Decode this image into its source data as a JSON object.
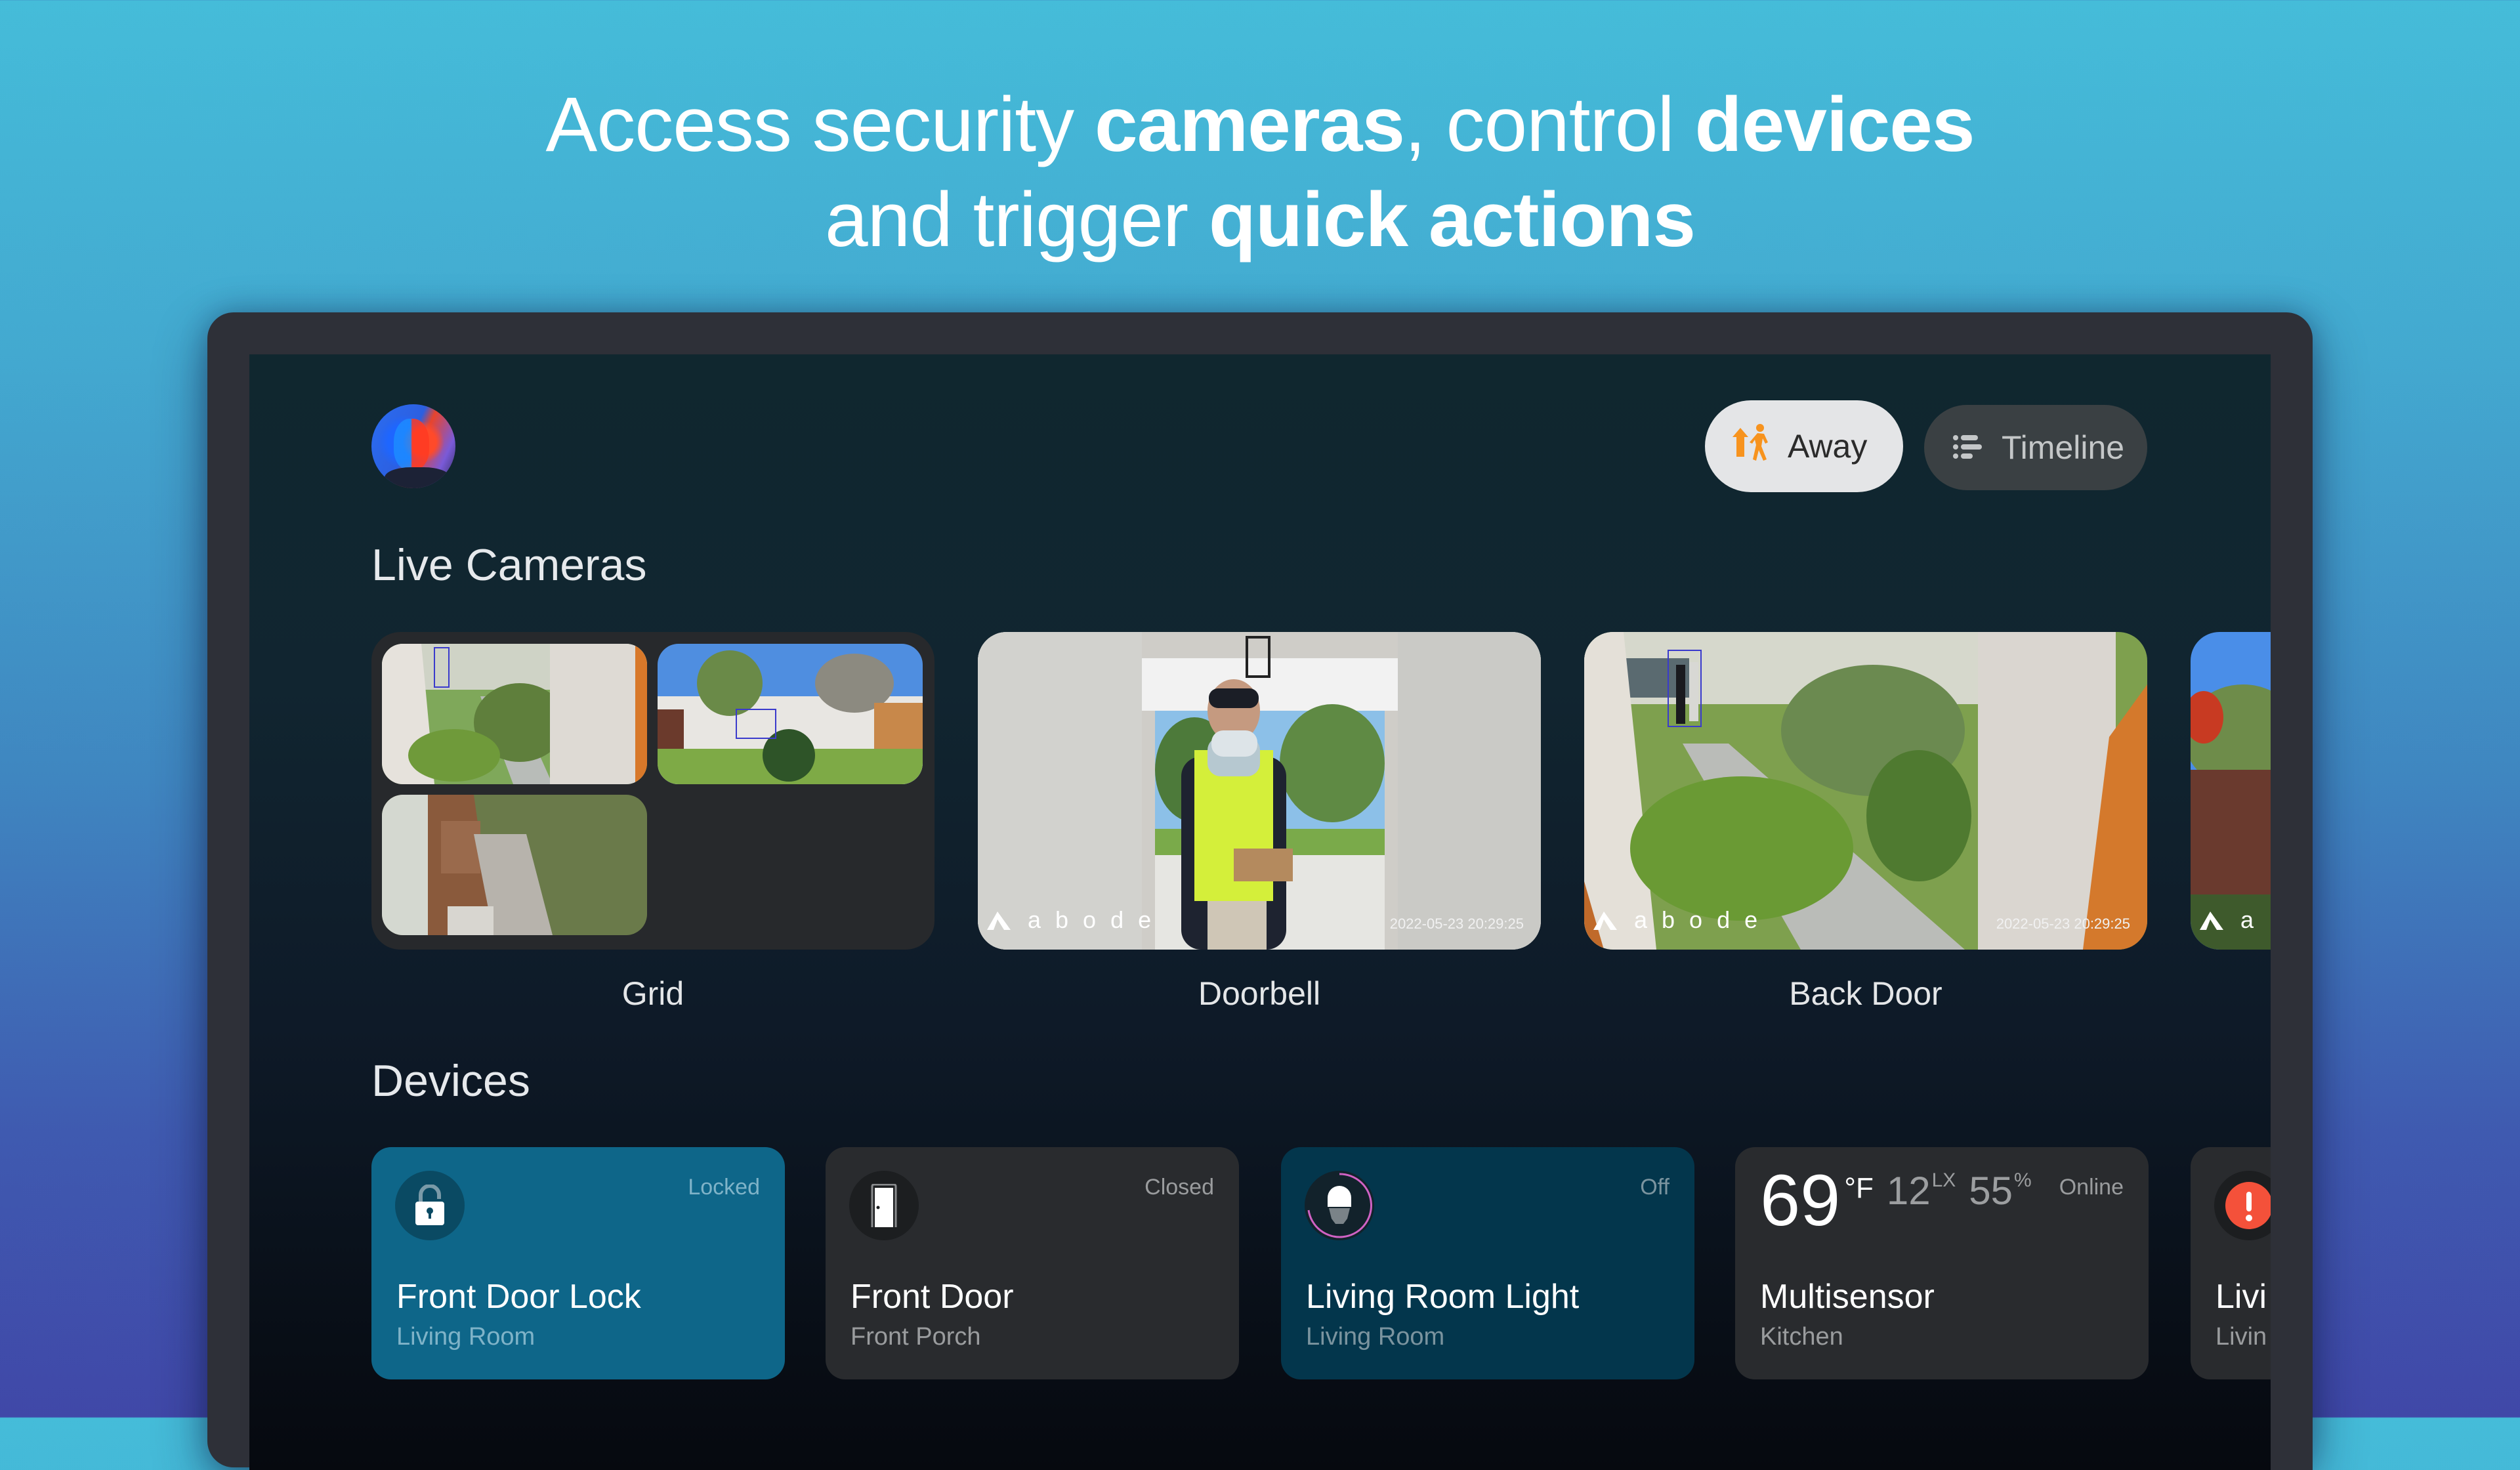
{
  "headline": {
    "line1": [
      {
        "text": "Access security ",
        "bold": false
      },
      {
        "text": "cameras",
        "bold": true
      },
      {
        "text": ", control ",
        "bold": false
      },
      {
        "text": "devices",
        "bold": true
      }
    ],
    "line2": [
      {
        "text": "and trigger ",
        "bold": false
      },
      {
        "text": "quick actions",
        "bold": true
      }
    ]
  },
  "header": {
    "avatar_alt": "User profile",
    "mode_button": {
      "label": "Away",
      "icon": "away-walking-icon",
      "icon_color": "#f7931e"
    },
    "timeline_button": {
      "label": "Timeline",
      "icon": "timeline-list-icon"
    }
  },
  "live_cameras": {
    "title": "Live Cameras",
    "cameras": [
      {
        "label": "Grid",
        "type": "grid",
        "tiles": 3
      },
      {
        "label": "Doorbell",
        "watermark": "abode",
        "timestamp": "2022-05-23  20:29:25"
      },
      {
        "label": "Back Door",
        "watermark": "abode",
        "timestamp": "2022-05-23  20:29:25"
      },
      {
        "label": "",
        "watermark": "a",
        "partial": true
      }
    ]
  },
  "devices": {
    "title": "Devices",
    "items": [
      {
        "name": "Front Door Lock",
        "room": "Living Room",
        "status": "Locked",
        "icon": "padlock-icon",
        "color": "#0e6689"
      },
      {
        "name": "Front Door",
        "room": "Front Porch",
        "status": "Closed",
        "icon": "door-icon",
        "color": "#292b2e"
      },
      {
        "name": "Living Room Light",
        "room": "Living Room",
        "status": "Off",
        "icon": "light-bulb-icon",
        "color": "#03364c",
        "ring_color": "#d062c4"
      },
      {
        "name": "Multisensor",
        "room": "Kitchen",
        "status": "Online",
        "readings": {
          "temperature": "69",
          "temp_unit": "°F",
          "light": "12",
          "light_unit": "LX",
          "humidity": "55",
          "humidity_unit": "%"
        }
      },
      {
        "name": "Livi",
        "room": "Livin",
        "status": "",
        "icon": "alert-icon",
        "alert_color": "#f4513a",
        "partial": true
      }
    ]
  }
}
